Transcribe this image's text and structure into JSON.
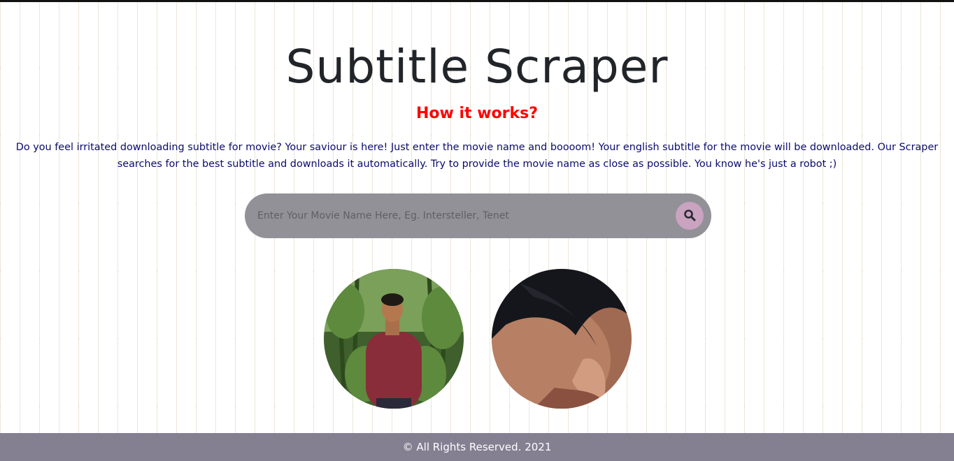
{
  "page": {
    "title": "Subtitle Scraper",
    "how_it_works": "How it works?",
    "description": "Do you feel irritated downloading subtitle for movie? Your saviour is here! Just enter the movie name and boooom! Your english subtitle for the movie will be downloaded. Our Scraper searches for the best subtitle and downloads it automatically. Try to provide the movie name as close as possible. You know he's just a robot ;)"
  },
  "search": {
    "value": "",
    "placeholder": "Enter Your Movie Name Here, Eg. Intersteller, Tenet",
    "button_icon": "search-icon"
  },
  "footer": {
    "text": "© All Rights Reserved. 2021"
  },
  "colors": {
    "title": "#212529",
    "how_it_works": "#ff0000",
    "description": "#0a0a6e",
    "search_bar": "#919197",
    "search_button": "#c9a3bf",
    "footer": "#857f92"
  }
}
